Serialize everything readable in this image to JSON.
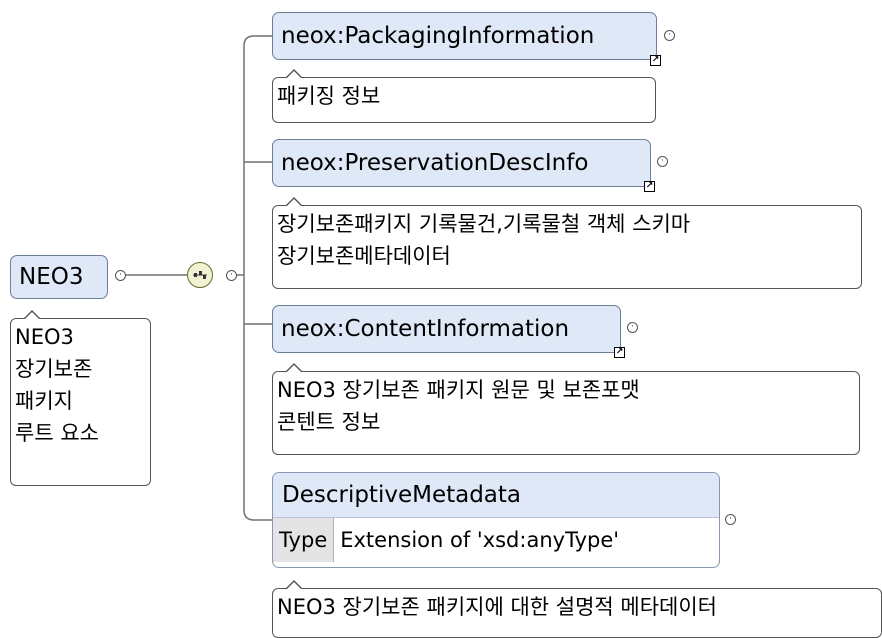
{
  "root": {
    "name": "NEO3",
    "doc_lines": [
      "NEO3",
      "장기보존",
      "패키지",
      "루트 요소"
    ]
  },
  "children": [
    {
      "name": "neox:PackagingInformation",
      "doc_lines": [
        "패키징 정보"
      ]
    },
    {
      "name": "neox:PreservationDescInfo",
      "doc_lines": [
        "장기보존패키지 기록물건,기록물철 객체 스키마",
        "장기보존메타데이터"
      ]
    },
    {
      "name": "neox:ContentInformation",
      "doc_lines": [
        "NEO3 장기보존 패키지 원문 및 보존포맷",
        "콘텐트 정보"
      ]
    },
    {
      "name": "DescriptiveMetadata",
      "type_label": "Type",
      "type_value": "Extension of 'xsd:anyType'",
      "doc_lines": [
        "NEO3 장기보존 패키지에 대한 설명적 메타데이터"
      ]
    }
  ],
  "icons": {
    "reference": "reference-arrow-icon",
    "expand": "expand-plus-icon",
    "sequence": "sequence-compositor-icon"
  },
  "colors": {
    "element_fill": "#dfe8f7",
    "element_border": "#6b7f9c",
    "connector": "#707070",
    "type_label_fill": "#e4e4e4"
  }
}
